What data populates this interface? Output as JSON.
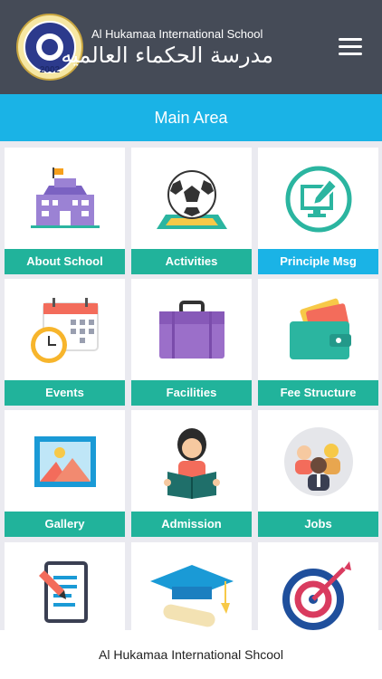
{
  "header": {
    "school_name_en": "Al Hukamaa International School",
    "school_name_ar": "مدرسة الحكماء العالميه",
    "logo_year": "2002",
    "menu_icon": "hamburger-menu-icon"
  },
  "main": {
    "title": "Main Area"
  },
  "tiles": [
    {
      "label": "About School",
      "icon": "school-building-icon"
    },
    {
      "label": "Activities",
      "icon": "soccer-ball-icon"
    },
    {
      "label": "Principle Msg",
      "icon": "computer-pen-icon"
    },
    {
      "label": "Events",
      "icon": "calendar-clock-icon"
    },
    {
      "label": "Facilities",
      "icon": "briefcase-icon"
    },
    {
      "label": "Fee Structure",
      "icon": "wallet-icon"
    },
    {
      "label": "Gallery",
      "icon": "picture-icon"
    },
    {
      "label": "Admission",
      "icon": "student-reading-icon"
    },
    {
      "label": "Jobs",
      "icon": "people-group-icon"
    },
    {
      "label": "",
      "icon": "document-pencil-icon"
    },
    {
      "label": "",
      "icon": "graduation-cap-icon"
    },
    {
      "label": "",
      "icon": "target-arrow-icon"
    }
  ],
  "footer": {
    "text": "Al Hukamaa International Shcool"
  },
  "colors": {
    "header_bg": "#454b57",
    "main_bar_bg": "#1ab3e6",
    "tile_label_bg": "#21b39b",
    "tile_label_active_bg": "#1ab3e6",
    "grid_bg": "#eaeaf0"
  }
}
